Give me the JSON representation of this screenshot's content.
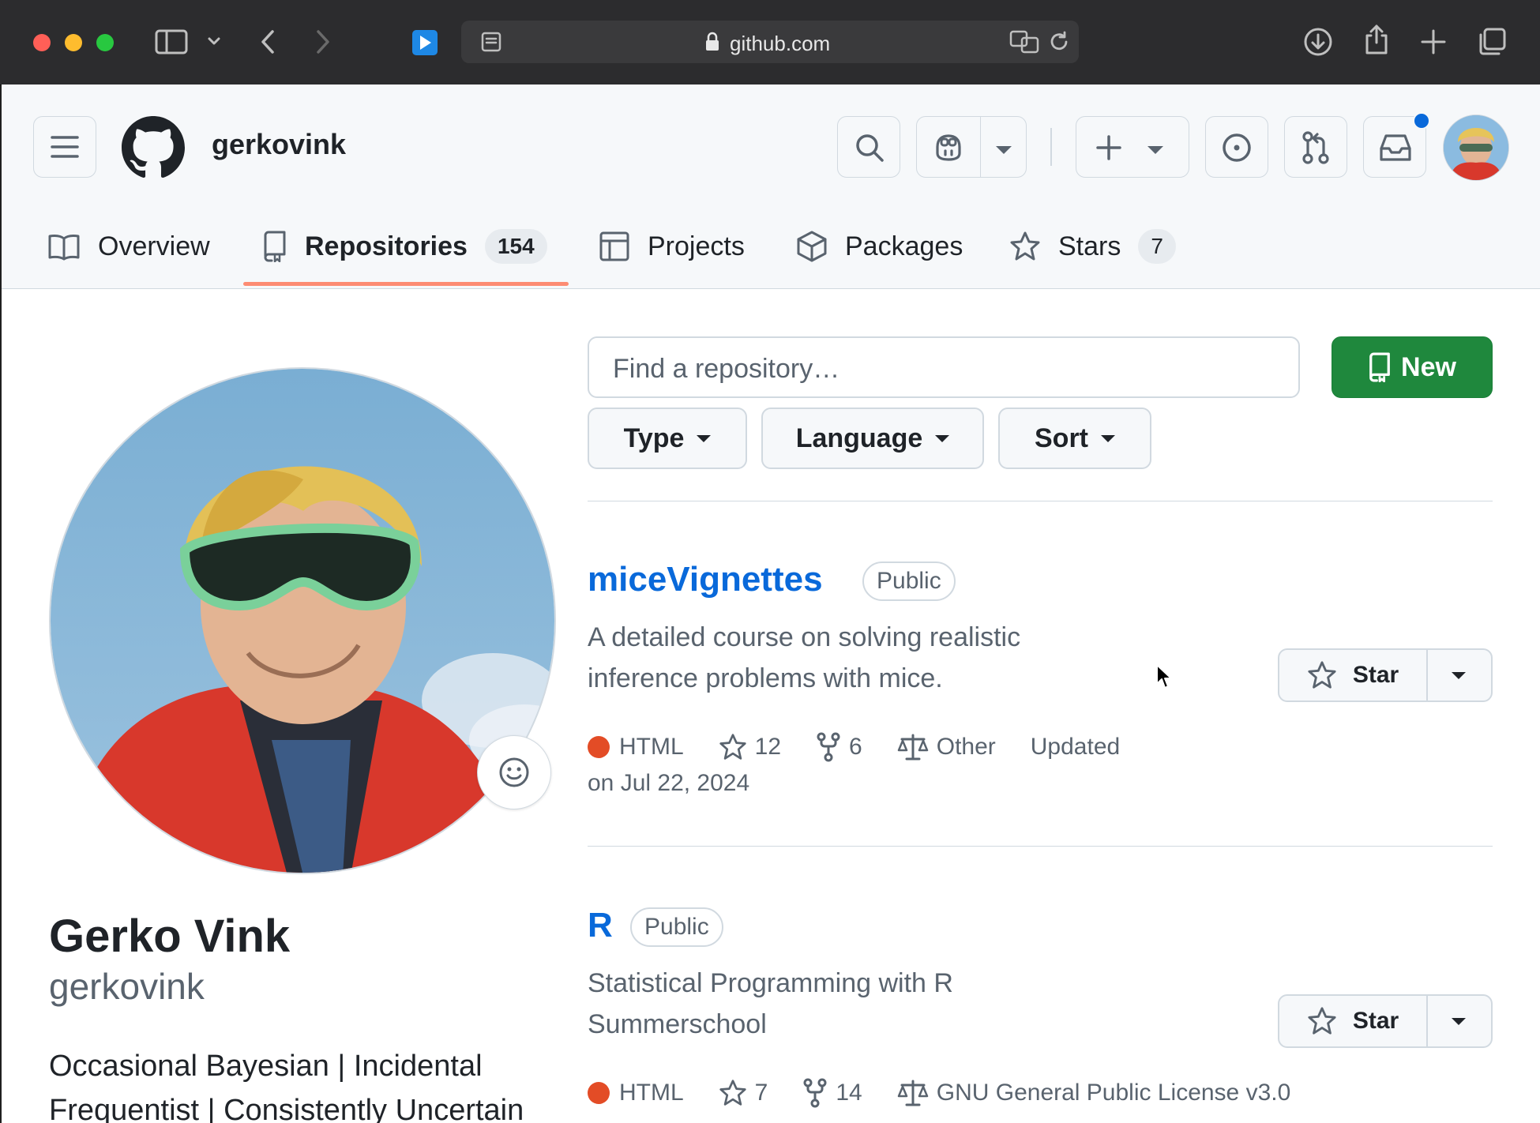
{
  "browser": {
    "url": "github.com"
  },
  "header": {
    "username": "gerkovink",
    "has_notification": true
  },
  "tabs": [
    {
      "label": "Overview",
      "icon": "book-icon"
    },
    {
      "label": "Repositories",
      "icon": "repo-icon",
      "count": "154",
      "active": true
    },
    {
      "label": "Projects",
      "icon": "table-icon"
    },
    {
      "label": "Packages",
      "icon": "package-icon"
    },
    {
      "label": "Stars",
      "icon": "star-icon",
      "count": "7"
    }
  ],
  "profile": {
    "name": "Gerko Vink",
    "login": "gerkovink",
    "bio": "Occasional Bayesian | Incidental Frequentist | Consistently Uncertain"
  },
  "repo_controls": {
    "search_placeholder": "Find a repository…",
    "new_label": "New",
    "filters": [
      "Type",
      "Language",
      "Sort"
    ]
  },
  "repos": [
    {
      "name": "miceVignettes",
      "visibility": "Public",
      "description": "A detailed course on solving realistic inference problems with mice.",
      "language": "HTML",
      "language_color": "#e34c26",
      "stars": "12",
      "forks": "6",
      "license": "Other",
      "updated_label": "Updated",
      "updated_date": "on Jul 22, 2024",
      "star_label": "Star"
    },
    {
      "name": "R",
      "visibility": "Public",
      "description": "Statistical Programming with R Summerschool",
      "language": "HTML",
      "language_color": "#e34c26",
      "stars": "7",
      "forks": "14",
      "license": "GNU General Public License v3.0",
      "star_label": "Star"
    }
  ],
  "colors": {
    "accent_blue": "#0969da",
    "new_button_green": "#1f883d",
    "tab_underline": "#fd8c73"
  }
}
